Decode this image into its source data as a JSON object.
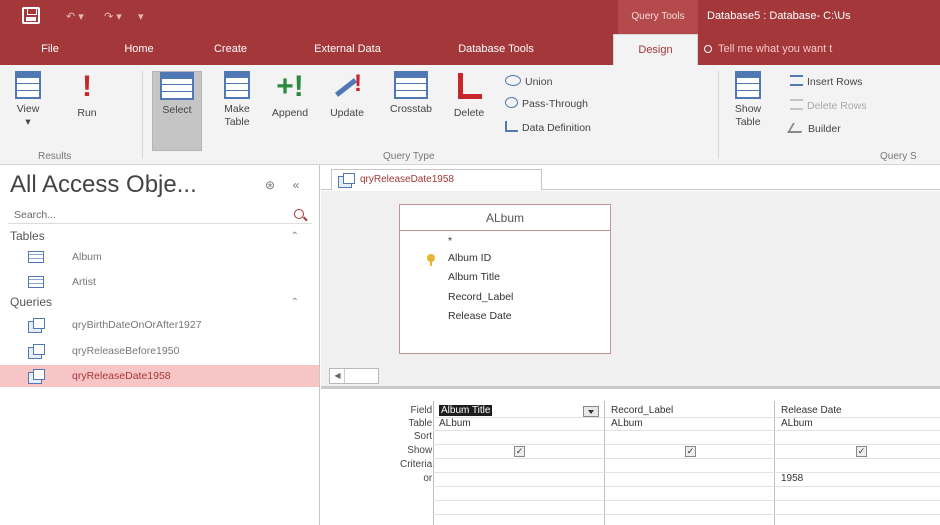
{
  "titlebar": {
    "context_tab": "Query Tools",
    "title": "Database5 : Database- C:\\Us"
  },
  "ribbon_tabs": [
    {
      "label": "File"
    },
    {
      "label": "Home"
    },
    {
      "label": "Create"
    },
    {
      "label": "External Data"
    },
    {
      "label": "Database Tools"
    },
    {
      "label": "Design"
    }
  ],
  "tell_me": "Tell me what you want t",
  "ribbon": {
    "view": "View",
    "run": "Run",
    "select": "Select",
    "make_table_1": "Make",
    "make_table_2": "Table",
    "append": "Append",
    "update": "Update",
    "crosstab": "Crosstab",
    "delete": "Delete",
    "union": "Union",
    "pass_through": "Pass-Through",
    "data_definition": "Data Definition",
    "show_table_1": "Show",
    "show_table_2": "Table",
    "insert_rows": "Insert Rows",
    "delete_rows": "Delete Rows",
    "builder": "Builder",
    "group_results": "Results",
    "group_query_type": "Query Type",
    "group_query_setup": "Query S"
  },
  "nav": {
    "title": "All Access Obje...",
    "search_placeholder": "Search...",
    "group_tables": "Tables",
    "group_queries": "Queries",
    "tables": [
      "Album",
      "Artist"
    ],
    "queries": [
      "qryBirthDateOnOrAfter1927",
      "qryReleaseBefore1950",
      "qryReleaseDate1958"
    ]
  },
  "doc_tab": "qryReleaseDate1958",
  "table_box": {
    "title": "ALbum",
    "fields": [
      "*",
      "Album ID",
      "Album Title",
      "Record_Label",
      "Release Date"
    ]
  },
  "qbe": {
    "row_labels": [
      "Field:",
      "Table:",
      "Sort:",
      "Show:",
      "Criteria:",
      "or:"
    ],
    "columns": [
      {
        "field": "Album Title",
        "table": "ALbum",
        "show": true,
        "criteria": ""
      },
      {
        "field": "Record_Label",
        "table": "ALbum",
        "show": true,
        "criteria": ""
      },
      {
        "field": "Release Date",
        "table": "ALbum",
        "show": true,
        "criteria": "1958"
      }
    ]
  },
  "colors": {
    "accent": "#a4373a",
    "selected_item": "#f8c5c6",
    "icon_blue": "#4f78b4"
  }
}
